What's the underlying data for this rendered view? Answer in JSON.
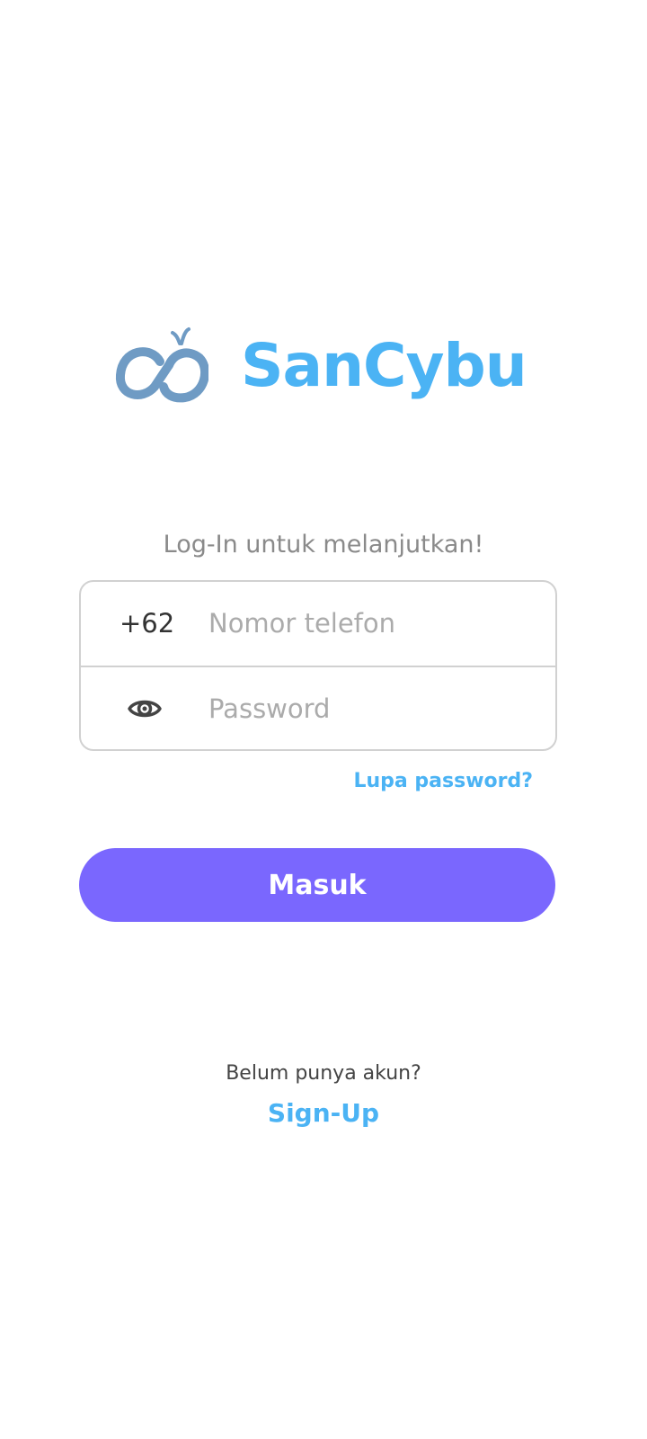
{
  "brand": {
    "name": "SanCybu",
    "logo_icon": "sancybu-logo-icon",
    "text_color": "#4bb3f4",
    "mark_color": "#6f9bc4"
  },
  "login": {
    "subtitle": "Log-In untuk melanjutkan!",
    "phone_prefix": "+62",
    "phone_placeholder": "Nomor telefon",
    "password_icon": "eye-icon",
    "password_placeholder": "Password",
    "forgot_password": "Lupa password?",
    "submit_label": "Masuk",
    "submit_color": "#7a67fe"
  },
  "signup": {
    "prompt": "Belum punya akun?",
    "link_label": "Sign-Up"
  }
}
